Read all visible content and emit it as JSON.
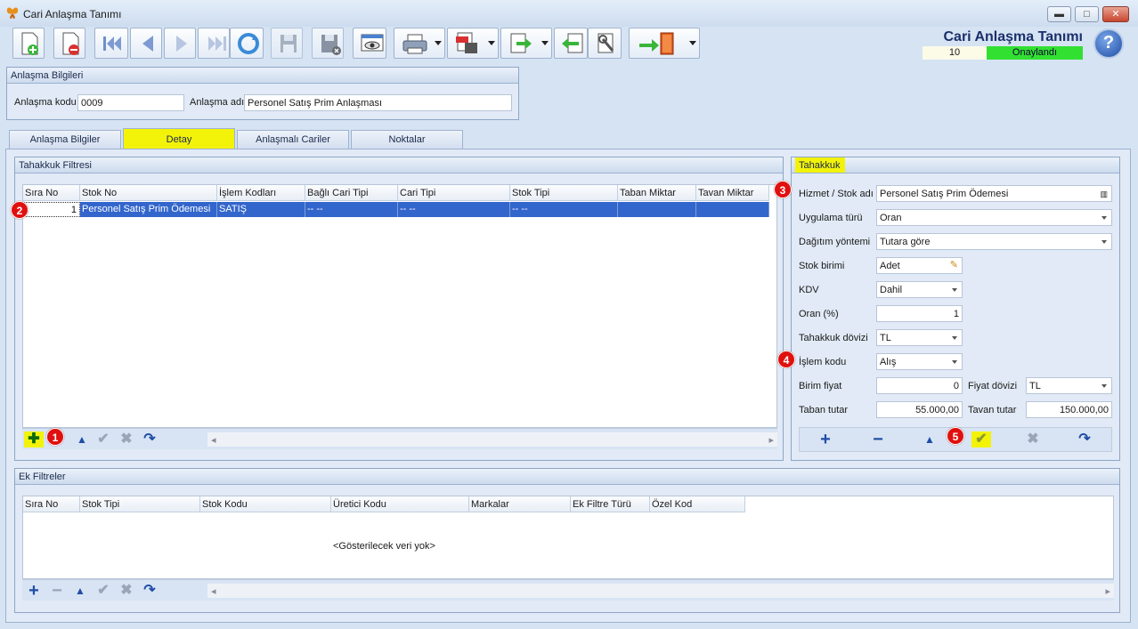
{
  "window": {
    "title": "Cari Anlaşma Tanımı",
    "controls": [
      "minimize",
      "maximize",
      "close"
    ]
  },
  "toolbar": {
    "icons": [
      "new-doc-icon",
      "delete-doc-icon",
      "first-icon",
      "prev-icon",
      "next-icon",
      "last-icon",
      "refresh-icon",
      "save-icon",
      "save-close-icon",
      "preview-icon",
      "print-icon",
      "pdf-icon",
      "export-icon",
      "import-icon",
      "tools-icon",
      "exit-icon"
    ]
  },
  "header": {
    "title": "Cari Anlaşma Tanımı",
    "record_no": "10",
    "status": "Onaylandı",
    "status_color": "#32e032"
  },
  "anlasma": {
    "group_title": "Anlaşma Bilgileri",
    "kod_label": "Anlaşma kodu",
    "kod_value": "0009",
    "ad_label": "Anlaşma adı",
    "ad_value": "Personel Satış Prim Anlaşması"
  },
  "tabs": [
    {
      "label": "Anlaşma Bilgiler",
      "active": false
    },
    {
      "label": "Detay",
      "active": true
    },
    {
      "label": "Anlaşmalı Cariler",
      "active": false
    },
    {
      "label": "Noktalar",
      "active": false
    }
  ],
  "tahakkuk_filtresi": {
    "title": "Tahakkuk Filtresi",
    "columns": [
      "Sıra No",
      "Stok No",
      "İşlem Kodları",
      "Bağlı Cari Tipi",
      "Cari Tipi",
      "Stok Tipi",
      "Taban Miktar",
      "Tavan Miktar"
    ],
    "rows": [
      [
        "1",
        "Personel Satış Prim Ödemesi",
        "SATIŞ",
        "-- --",
        "-- --",
        "-- --",
        "",
        ""
      ]
    ]
  },
  "tahakkuk": {
    "title": "Tahakkuk",
    "hizmet_label": "Hizmet / Stok adı",
    "hizmet_value": "Personel Satış Prim Ödemesi",
    "uygulama_label": "Uygulama türü",
    "uygulama_value": "Oran",
    "dagitim_label": "Dağıtım yöntemi",
    "dagitim_value": "Tutara göre",
    "birim_label": "Stok birimi",
    "birim_value": "Adet",
    "kdv_label": "KDV",
    "kdv_value": "Dahil",
    "oran_label": "Oran (%)",
    "oran_value": "1",
    "doviz_label": "Tahakkuk dövizi",
    "doviz_value": "TL",
    "islem_label": "İşlem kodu",
    "islem_value": "Alış",
    "fiyat_label": "Birim fiyat",
    "fiyat_value": "0",
    "fdoviz_label": "Fiyat dövizi",
    "fdoviz_value": "TL",
    "taban_label": "Taban tutar",
    "taban_value": "55.000,00",
    "tavan_label": "Tavan tutar",
    "tavan_value": "150.000,00"
  },
  "ek_filtreler": {
    "title": "Ek Filtreler",
    "columns": [
      "Sıra No",
      "Stok Tipi",
      "Stok Kodu",
      "Üretici Kodu",
      "Markalar",
      "Ek Filtre Türü",
      "Özel Kod"
    ],
    "empty_text": "<Gösterilecek veri yok>"
  },
  "badges": [
    "1",
    "2",
    "3",
    "4",
    "5"
  ],
  "highlight_color": "#f3f30a"
}
